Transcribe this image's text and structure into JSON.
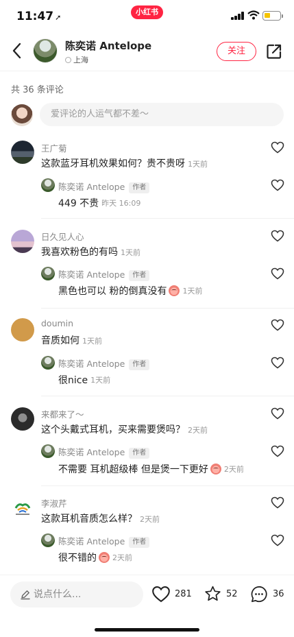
{
  "status_bar": {
    "time": "11:47",
    "app_pill": "小红书"
  },
  "header": {
    "author_name": "陈奕诺 Antelope",
    "location": "上海",
    "follow_label": "关注"
  },
  "comment_count": "共 36 条评论",
  "compose_placeholder": "爱评论的人运气都不差～",
  "comments": [
    {
      "name": "王广菊",
      "text": "这款蓝牙耳机效果如何？贵不贵呀",
      "time": "1天前",
      "reply": {
        "name": "陈奕诺 Antelope",
        "badge": "作者",
        "text": "449 不贵",
        "time": "昨天 16:09"
      }
    },
    {
      "name": "日久见人心",
      "text": "我喜欢粉色的有吗",
      "time": "1天前",
      "reply": {
        "name": "陈奕诺 Antelope",
        "badge": "作者",
        "text": "黑色也可以 粉的倒真没有",
        "time": "1天前"
      }
    },
    {
      "name": "doumin",
      "text": "音质如何",
      "time": "1天前",
      "reply": {
        "name": "陈奕诺 Antelope",
        "badge": "作者",
        "text": "很nice",
        "time": "1天前"
      }
    },
    {
      "name": "来都来了～",
      "text": "这个头戴式耳机，买来需要煲吗？",
      "time": "2天前",
      "reply": {
        "name": "陈奕诺 Antelope",
        "badge": "作者",
        "text": "不需要 耳机超级棒 但是煲一下更好",
        "time": "2天前"
      }
    },
    {
      "name": "李淑芹",
      "text": "这款耳机音质怎么样？",
      "time": "2天前",
      "reply": {
        "name": "陈奕诺 Antelope",
        "badge": "作者",
        "text": "很不错的",
        "time": "2天前"
      }
    }
  ],
  "bottom_bar": {
    "input_placeholder": "说点什么...",
    "likes": "281",
    "favorites": "52",
    "comments": "36"
  },
  "colors": {
    "brand": "#ff2442",
    "muted_text": "#888888",
    "input_bg": "#f5f5f5"
  }
}
